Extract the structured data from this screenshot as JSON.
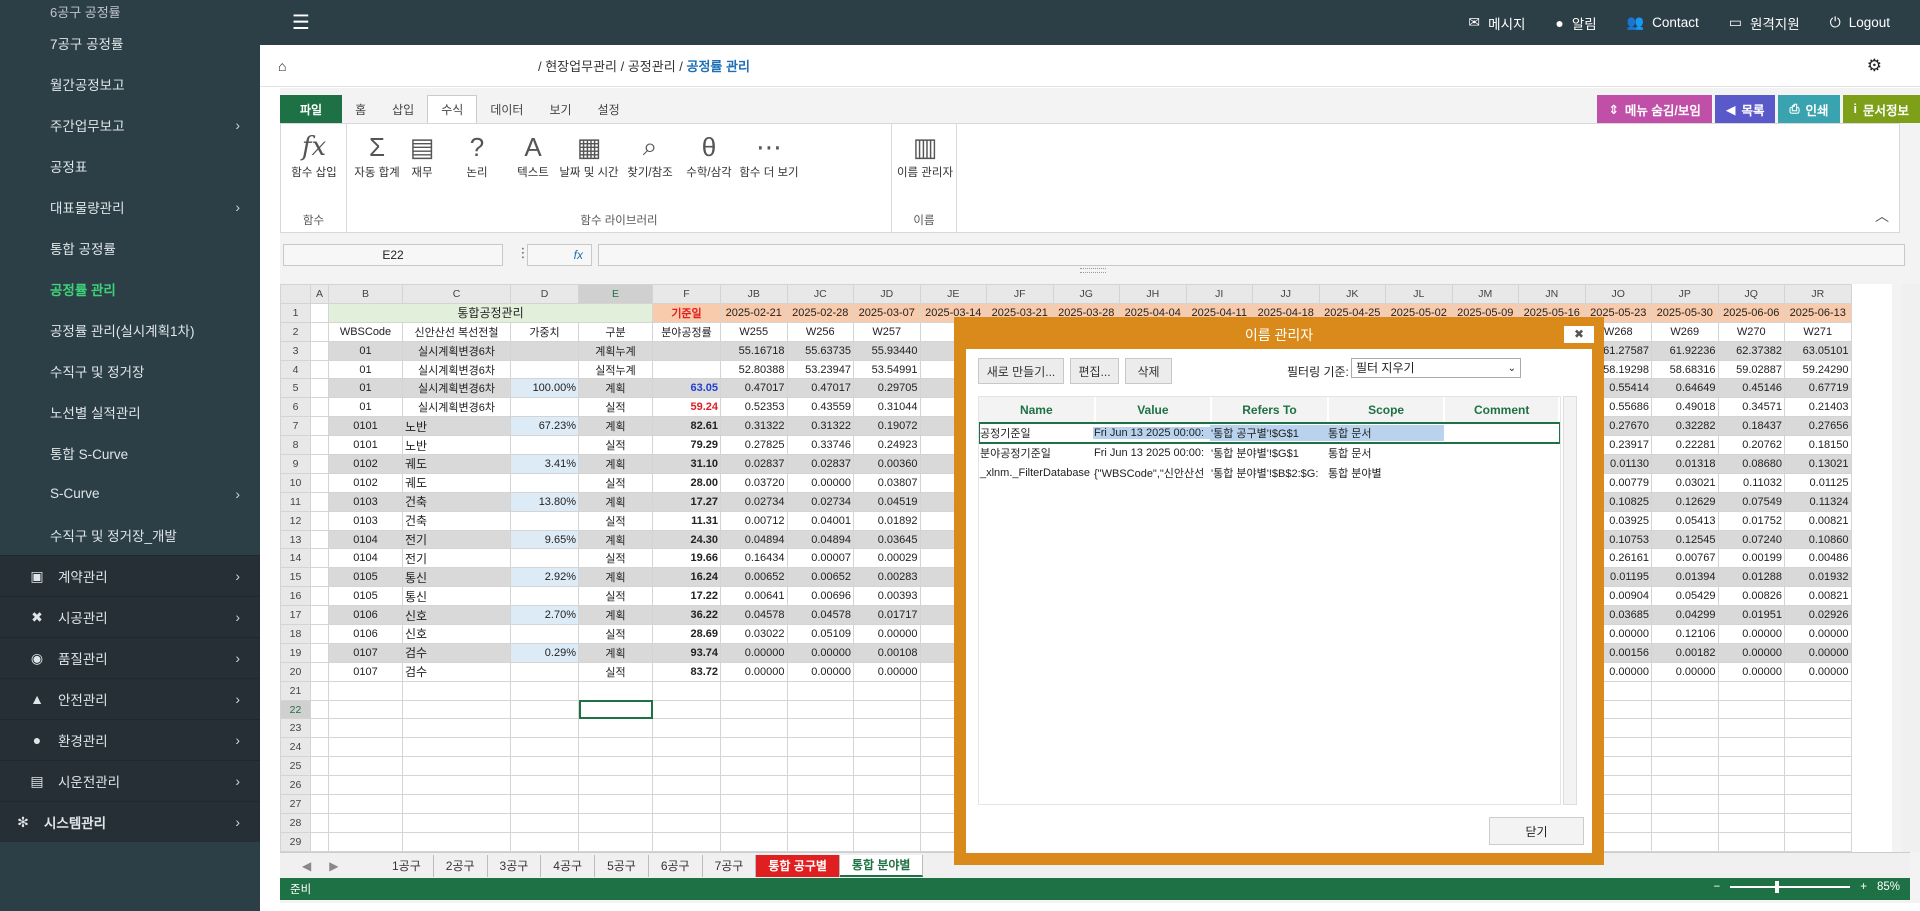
{
  "topbar": {
    "menu": [
      {
        "icon": "message-icon",
        "label": "메시지"
      },
      {
        "icon": "alert-icon",
        "label": "알림"
      },
      {
        "icon": "contact-icon",
        "label": "Contact"
      },
      {
        "icon": "remote-icon",
        "label": "원격지원"
      },
      {
        "icon": "logout-icon",
        "label": "Logout"
      }
    ]
  },
  "sidebar": {
    "cut_item": "6공구 공정률",
    "items": [
      "7공구 공정률",
      "월간공정보고",
      "주간업무보고",
      "공정표",
      "대표물량관리",
      "통합 공정률",
      "공정률 관리",
      "공정률 관리(실시계획1차)",
      "수직구 및 정거장",
      "노선별 실적관리",
      "통합 S-Curve",
      "S-Curve",
      "수직구 및 정거장_개발"
    ],
    "mains": [
      "계약관리",
      "시공관리",
      "품질관리",
      "안전관리",
      "환경관리",
      "시운전관리",
      "시스템관리"
    ]
  },
  "breadcrumb": {
    "part1": "/ 현장업무관리 / 공정관리 / ",
    "current": "공정률 관리"
  },
  "ribbon": {
    "tabs": [
      "파일",
      "홈",
      "삽입",
      "수식",
      "데이터",
      "보기",
      "설정"
    ],
    "right_buttons": [
      "메뉴 숨김/보임",
      "목록",
      "인쇄",
      "문서정보"
    ],
    "groups": {
      "func": "함수",
      "lib": "함수 라이브러리",
      "name": "이름"
    },
    "buttons": {
      "insert_fn": "함수 삽입",
      "autosum": "자동 합계",
      "finance": "재무",
      "logic": "논리",
      "text": "텍스트",
      "datetime": "날짜 및 시간",
      "lookup": "찾기/참조",
      "math": "수학/삼각",
      "more": "함수 더 보기",
      "name_mgr": "이름 관리자"
    }
  },
  "formula": {
    "namebox": "E22",
    "fx": "fx",
    "value": ""
  },
  "grid": {
    "col_letters": [
      "A",
      "B",
      "C",
      "D",
      "E",
      "F",
      "JB",
      "JC",
      "JD",
      "JE",
      "JF",
      "JG",
      "JH",
      "JI",
      "JJ",
      "JK",
      "JL",
      "JM",
      "JN",
      "JO",
      "JP",
      "JQ",
      "JR"
    ],
    "dates": [
      "2025-02-21",
      "2025-02-28",
      "2025-03-07",
      "2025-03-14",
      "2025-03-21",
      "2025-03-28",
      "2025-04-04",
      "2025-04-11",
      "2025-04-18",
      "2025-04-25",
      "2025-05-02",
      "2025-05-09",
      "2025-05-16",
      "2025-05-23",
      "2025-05-30",
      "2025-06-06",
      "2025-06-13"
    ],
    "weeks_left": [
      "W255",
      "W256",
      "W257"
    ],
    "weeks_right": [
      "W268",
      "W269",
      "W270",
      "W271"
    ],
    "title": "통합공정관리",
    "base_date": "기준일",
    "headers": [
      "WBSCode",
      "신안산선 복선전철",
      "가중치",
      "구분",
      "분야공정률"
    ],
    "rows": [
      [
        "01",
        "실시계획변경6차",
        "",
        "계획누계",
        "",
        "55.16718",
        "55.63735",
        "55.93440",
        "61.27587",
        "61.92236",
        "62.37382",
        "63.05101"
      ],
      [
        "01",
        "실시계획변경6차",
        "",
        "실적누계",
        "",
        "52.80388",
        "53.23947",
        "53.54991",
        "58.19298",
        "58.68316",
        "59.02887",
        "59.24290"
      ],
      [
        "01",
        "실시계획변경6차",
        "100.00%",
        "계획",
        "63.05",
        "0.47017",
        "0.47017",
        "0.29705",
        "0.55414",
        "0.64649",
        "0.45146",
        "0.67719"
      ],
      [
        "01",
        "실시계획변경6차",
        "",
        "실적",
        "59.24",
        "0.52353",
        "0.43559",
        "0.31044",
        "0.55686",
        "0.49018",
        "0.34571",
        "0.21403"
      ],
      [
        "0101",
        "노반",
        "67.23%",
        "계획",
        "82.61",
        "0.31322",
        "0.31322",
        "0.19072",
        "0.27670",
        "0.32282",
        "0.18437",
        "0.27656"
      ],
      [
        "0101",
        "노반",
        "",
        "실적",
        "79.29",
        "0.27825",
        "0.33746",
        "0.24923",
        "0.23917",
        "0.22281",
        "0.20762",
        "0.18150"
      ],
      [
        "0102",
        "궤도",
        "3.41%",
        "계획",
        "31.10",
        "0.02837",
        "0.02837",
        "0.00360",
        "0.01130",
        "0.01318",
        "0.08680",
        "0.13021"
      ],
      [
        "0102",
        "궤도",
        "",
        "실적",
        "28.00",
        "0.03720",
        "0.00000",
        "0.03807",
        "0.00779",
        "0.03021",
        "0.11032",
        "0.01125"
      ],
      [
        "0103",
        "건축",
        "13.80%",
        "계획",
        "17.27",
        "0.02734",
        "0.02734",
        "0.04519",
        "0.10825",
        "0.12629",
        "0.07549",
        "0.11324"
      ],
      [
        "0103",
        "건축",
        "",
        "실적",
        "11.31",
        "0.00712",
        "0.04001",
        "0.01892",
        "0.03925",
        "0.05413",
        "0.01752",
        "0.00821"
      ],
      [
        "0104",
        "전기",
        "9.65%",
        "계획",
        "24.30",
        "0.04894",
        "0.04894",
        "0.03645",
        "0.10753",
        "0.12545",
        "0.07240",
        "0.10860"
      ],
      [
        "0104",
        "전기",
        "",
        "실적",
        "19.66",
        "0.16434",
        "0.00007",
        "0.00029",
        "0.26161",
        "0.00767",
        "0.00199",
        "0.00486"
      ],
      [
        "0105",
        "통신",
        "2.92%",
        "계획",
        "16.24",
        "0.00652",
        "0.00652",
        "0.00283",
        "0.01195",
        "0.01394",
        "0.01288",
        "0.01932"
      ],
      [
        "0105",
        "통신",
        "",
        "실적",
        "17.22",
        "0.00641",
        "0.00696",
        "0.00393",
        "0.00904",
        "0.05429",
        "0.00826",
        "0.00821"
      ],
      [
        "0106",
        "신호",
        "2.70%",
        "계획",
        "36.22",
        "0.04578",
        "0.04578",
        "0.01717",
        "0.03685",
        "0.04299",
        "0.01951",
        "0.02926"
      ],
      [
        "0106",
        "신호",
        "",
        "실적",
        "28.69",
        "0.03022",
        "0.05109",
        "0.00000",
        "0.00000",
        "0.12106",
        "0.00000",
        "0.00000"
      ],
      [
        "0107",
        "검수",
        "0.29%",
        "계획",
        "93.74",
        "0.00000",
        "0.00000",
        "0.00108",
        "0.00156",
        "0.00182",
        "0.00000",
        "0.00000"
      ],
      [
        "0107",
        "검수",
        "",
        "실적",
        "83.72",
        "0.00000",
        "0.00000",
        "0.00000",
        "0.00000",
        "0.00000",
        "0.00000",
        "0.00000"
      ]
    ]
  },
  "sheets": [
    "1공구",
    "2공구",
    "3공구",
    "4공구",
    "5공구",
    "6공구",
    "7공구",
    "통합 공구별",
    "통합 분야별"
  ],
  "status": {
    "ready": "준비",
    "zoom": "85%",
    "zoom_level": 0.85
  },
  "dialog": {
    "title": "이름 관리자",
    "btn_new": "새로 만들기...",
    "btn_edit": "편집...",
    "btn_delete": "삭제",
    "filter_label": "필터링 기준:",
    "filter_value": "필터 지우기",
    "columns": [
      "Name",
      "Value",
      "Refers To",
      "Scope",
      "Comment"
    ],
    "rows": [
      [
        "공정기준일",
        "Fri Jun 13 2025 00:00:",
        "'통합 공구별'!$G$1",
        "통합 문서",
        ""
      ],
      [
        "분야공정기준일",
        "Fri Jun 13 2025 00:00:",
        "'통합 분야별'!$G$1",
        "통합 문서",
        ""
      ],
      [
        "_xlnm._FilterDatabase",
        "{\"WBSCode\",\"신안산선",
        "'통합 분야별'!$B$2:$G:",
        "통합 분야별",
        ""
      ]
    ],
    "close": "닫기"
  }
}
